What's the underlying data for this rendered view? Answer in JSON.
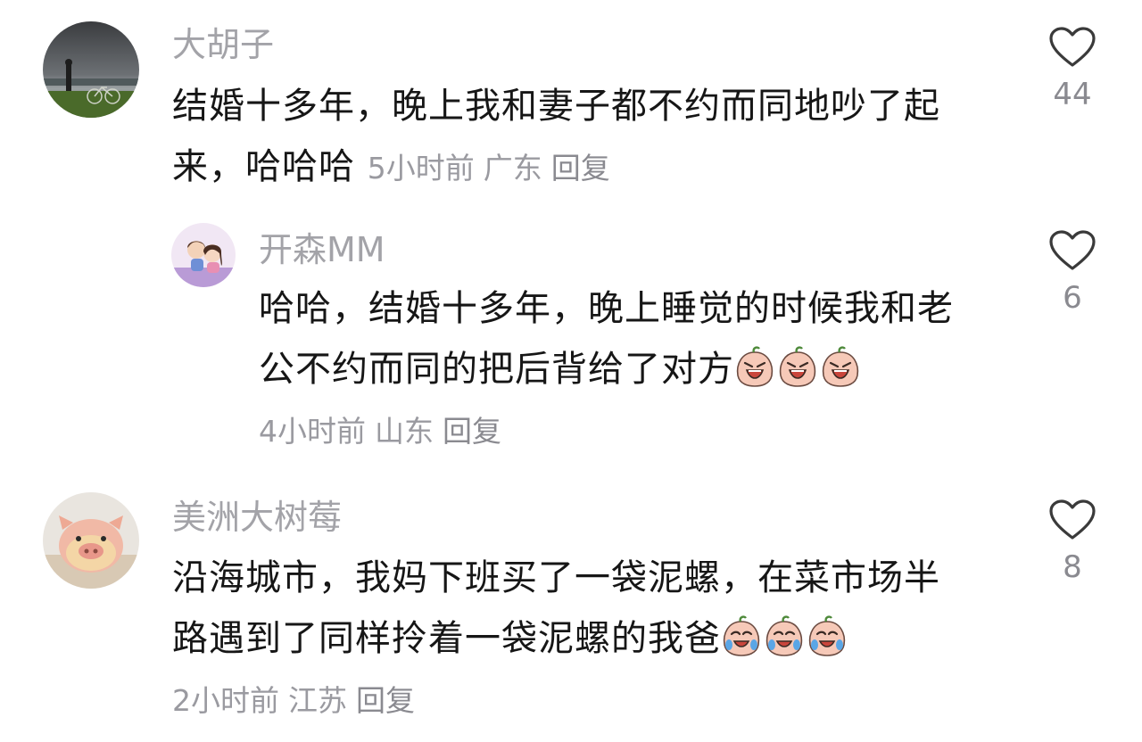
{
  "comments": [
    {
      "username": "大胡子",
      "text": "结婚十多年，晚上我和妻子都不约而同地吵了起来，哈哈哈",
      "time": "5小时前",
      "location": "广东",
      "reply": "回复",
      "likes": "44"
    },
    {
      "username": "开森MM",
      "text": "哈哈，结婚十多年，晚上睡觉的时候我和老公不约而同的把后背给了对方",
      "time": "4小时前",
      "location": "山东",
      "reply": "回复",
      "likes": "6"
    },
    {
      "username": "美洲大树莓",
      "text": "沿海城市，我妈下班买了一袋泥螺，在菜市场半路遇到了同样拎着一袋泥螺的我爸",
      "time": "2小时前",
      "location": "江苏",
      "reply": "回复",
      "likes": "8"
    }
  ],
  "icons": {
    "like": "heart-outline-icon",
    "emoji": "crying-peach-emoji"
  },
  "colors": {
    "username": "#a3a3a8",
    "text": "#161616",
    "meta": "#9a9aa0",
    "heart_stroke": "#3a3a3a"
  }
}
